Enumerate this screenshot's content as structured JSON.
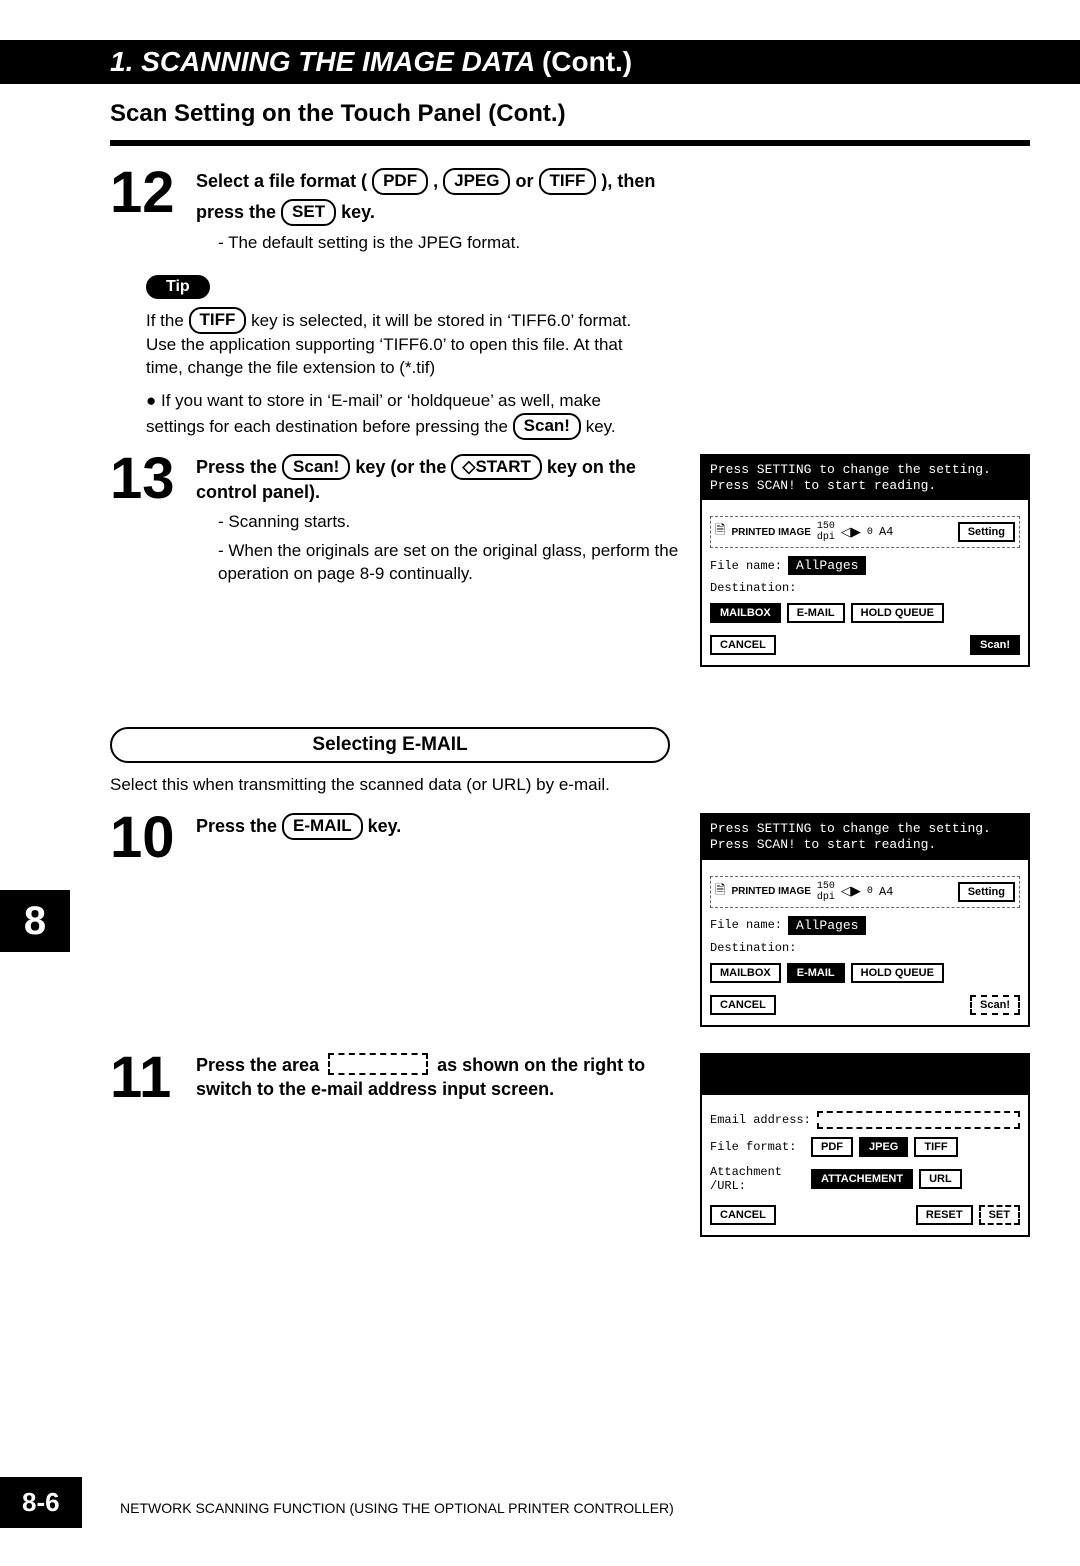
{
  "header": {
    "num": "1.",
    "title": "SCANNING THE IMAGE DATA",
    "cont": "(Cont.)"
  },
  "subhead": "Scan Setting on the Touch Panel (Cont.)",
  "step12": {
    "num": "12",
    "lead1": "Select a file format (",
    "k_pdf": "PDF",
    "comma": " , ",
    "k_jpeg": "JPEG",
    "or": " or ",
    "k_tiff": "TIFF",
    "lead2": "), then",
    "lead3": "press the ",
    "k_set": "SET",
    "lead4": " key.",
    "bullet": "- The default setting is the JPEG format."
  },
  "tip": {
    "label": "Tip",
    "line1a": "If the ",
    "k_tiff": "TIFF",
    "line1b": " key is selected, it will be stored in ‘TIFF6.0’ format. Use the application supporting ‘TIFF6.0’ to open this file. At that time, change the file extension to (*.tif)",
    "line2a": "If you want to store in ‘E-mail’ or ‘holdqueue’ as well, make settings for each destination before pressing the ",
    "k_scan": "Scan!",
    "line2b": " key."
  },
  "step13": {
    "num": "13",
    "t1": "Press the ",
    "k_scan": "Scan!",
    "t2": " key (or the ",
    "k_start": "◇START",
    "t3": " key on the control panel).",
    "b1": "- Scanning starts.",
    "b2": "- When the originals are set on the original glass, perform the operation on page 8-9 continually."
  },
  "screenA": {
    "head": "Press SETTING to change the setting.\nPress SCAN! to start reading.",
    "printed": "PRINTED IMAGE",
    "dpi": "150\ndpi",
    "zero": "0",
    "size": "A4",
    "setting": "Setting",
    "fnlabel": "File name:",
    "fn": "AllPages",
    "dest": "Destination:",
    "mailbox": "MAILBOX",
    "email": "E-MAIL",
    "hold": "HOLD QUEUE",
    "cancel": "CANCEL",
    "scan": "Scan!"
  },
  "section": {
    "title": "Selecting E-MAIL",
    "desc": "Select this when transmitting the scanned data (or URL) by e-mail."
  },
  "step10": {
    "num": "10",
    "t1": "Press the ",
    "key": "E-MAIL",
    "t2": " key."
  },
  "step11": {
    "num": "11",
    "t1": "Press the area ",
    "t2": " as shown on the right to switch to the e-mail address input screen."
  },
  "screenC": {
    "email": "Email address:",
    "ff": "File format:",
    "pdf": "PDF",
    "jpeg": "JPEG",
    "tiff": "TIFF",
    "att": "Attachment\n/URL:",
    "attbtn": "ATTACHEMENT",
    "url": "URL",
    "cancel": "CANCEL",
    "reset": "RESET",
    "set": "SET"
  },
  "sidetab": "8",
  "pagenum": "8-6",
  "footer": "NETWORK SCANNING FUNCTION (USING THE OPTIONAL PRINTER CONTROLLER)"
}
